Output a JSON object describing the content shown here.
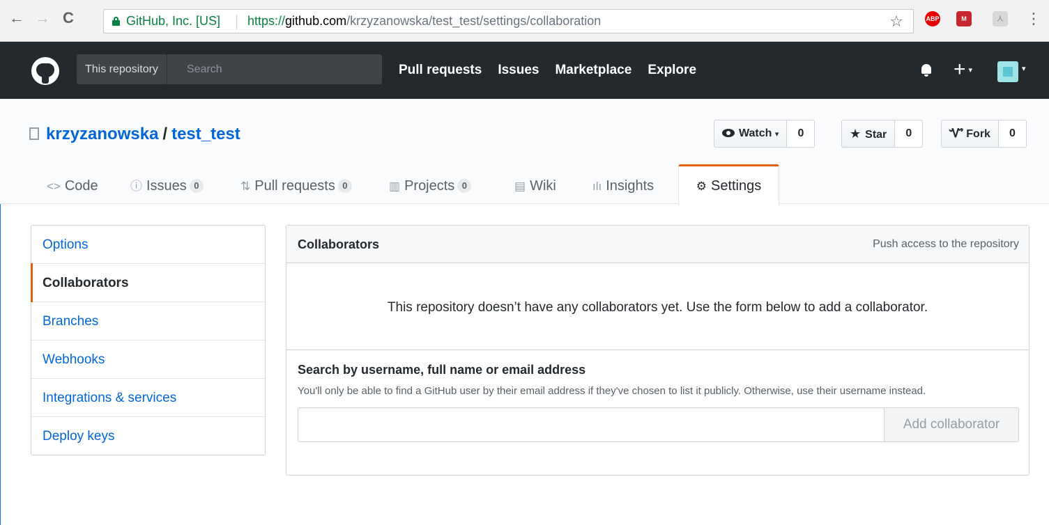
{
  "browser": {
    "secure_label": "GitHub, Inc. [US]",
    "url_scheme": "https://",
    "url_host": "github.com",
    "url_path": "/krzyzanowska/test_test/settings/collaboration",
    "back_icon": "←",
    "forward_icon": "→",
    "reload_icon": "C",
    "bookmark_icon": "☆",
    "menu_icon": "⋮",
    "ext_abp": "ABP",
    "ext_m": "M"
  },
  "header": {
    "search_scope": "This repository",
    "search_placeholder": "Search",
    "nav": [
      "Pull requests",
      "Issues",
      "Marketplace",
      "Explore"
    ],
    "plus_icon": "+",
    "caret": "▾"
  },
  "repo": {
    "owner": "krzyzanowska",
    "separator": "/",
    "name": "test_test",
    "watch_label": "Watch",
    "watch_count": "0",
    "star_label": "Star",
    "star_count": "0",
    "fork_label": "Fork",
    "fork_count": "0",
    "star_icon": "★",
    "fork_icon": "Ꮙ"
  },
  "tabs": [
    {
      "label": "Code",
      "icon": "<>",
      "counter": ""
    },
    {
      "label": "Issues",
      "icon": "ⓘ",
      "counter": "0"
    },
    {
      "label": "Pull requests",
      "icon": "⇅",
      "counter": "0"
    },
    {
      "label": "Projects",
      "icon": "▥",
      "counter": "0"
    },
    {
      "label": "Wiki",
      "icon": "▤",
      "counter": ""
    },
    {
      "label": "Insights",
      "icon": "ılı",
      "counter": ""
    },
    {
      "label": "Settings",
      "icon": "⚙",
      "counter": ""
    }
  ],
  "sidebar": {
    "items": [
      "Options",
      "Collaborators",
      "Branches",
      "Webhooks",
      "Integrations & services",
      "Deploy keys"
    ]
  },
  "collaborators": {
    "title": "Collaborators",
    "note": "Push access to the repository",
    "empty_message": "This repository doesn’t have any collaborators yet. Use the form below to add a collaborator.",
    "search_label": "Search by username, full name or email address",
    "search_note": "You'll only be able to find a GitHub user by their email address if they've chosen to list it publicly. Otherwise, use their username instead.",
    "input_value": "",
    "button_label": "Add collaborator"
  },
  "colors": {
    "header_bg": "#24292e",
    "link": "#0366d6",
    "selected_accent": "#e36209",
    "secure_green": "#0b8043"
  }
}
